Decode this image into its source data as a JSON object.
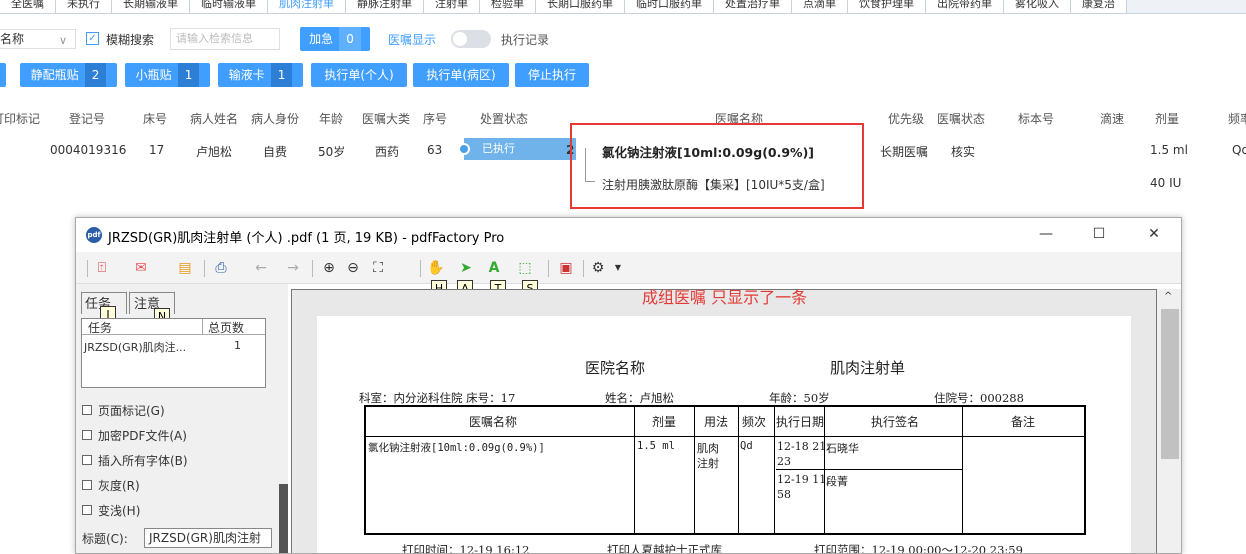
{
  "top_tabs": [
    {
      "label": "全医嘱",
      "active": false
    },
    {
      "label": "未执行",
      "active": false
    },
    {
      "label": "长期输液单",
      "active": false
    },
    {
      "label": "临时输液单",
      "active": false
    },
    {
      "label": "肌肉注射单",
      "active": true
    },
    {
      "label": "静脉注射单",
      "active": false
    },
    {
      "label": "注射单",
      "active": false
    },
    {
      "label": "检验单",
      "active": false
    },
    {
      "label": "长期口服药单",
      "active": false
    },
    {
      "label": "临时口服药单",
      "active": false
    },
    {
      "label": "处置治疗单",
      "active": false
    },
    {
      "label": "点滴单",
      "active": false
    },
    {
      "label": "饮食护理单",
      "active": false
    },
    {
      "label": "出院带药单",
      "active": false
    },
    {
      "label": "雾化吸入",
      "active": false
    },
    {
      "label": "康复治",
      "active": false
    }
  ],
  "filter": {
    "select_value": "名称",
    "fuzzy_checked": true,
    "fuzzy_label": "模糊搜索",
    "search_placeholder": "请输入检索信息",
    "urgent_label": "加急",
    "urgent_count": "0",
    "show_label": "医嘱显示",
    "exec_record_label": "执行记录"
  },
  "actions": [
    {
      "label": "静配瓶贴",
      "count": "2"
    },
    {
      "label": "小瓶贴",
      "count": "1"
    },
    {
      "label": "输液卡",
      "count": "1"
    },
    {
      "label": "执行单(个人)"
    },
    {
      "label": "执行单(病区)"
    },
    {
      "label": "停止执行"
    }
  ],
  "columns": [
    "打印标记",
    "登记号",
    "床号",
    "病人姓名",
    "病人身份",
    "年龄",
    "医嘱大类",
    "序号",
    "处置状态",
    "医嘱名称",
    "优先级",
    "医嘱状态",
    "标本号",
    "滴速",
    "剂量",
    "频率"
  ],
  "row": {
    "reg_no": "0004019316",
    "bed": "17",
    "name": "卢旭松",
    "identity": "自费",
    "age": "50岁",
    "category": "西药",
    "seq": "63",
    "status": "已执行",
    "status_num": "2",
    "priority": "长期医嘱",
    "order_status": "核实",
    "freq": "Qd"
  },
  "orders": [
    {
      "name": "氯化钠注射液[10ml:0.09g(0.9%)]",
      "dose": "1.5 ml"
    },
    {
      "name": "注射用胰激肽原酶【集采】[10IU*5支/盒]",
      "dose": "40 IU"
    }
  ],
  "pdf": {
    "window_title": "JRZSD(GR)肌肉注射单 (个人) .pdf (1 页, 19 KB) - pdfFactory Pro",
    "logo_text": "pdf",
    "hotkeys": [
      "H",
      "A",
      "T",
      "S"
    ],
    "side_hotkeys": [
      "J",
      "N"
    ],
    "annotation": "成组医嘱 只显示了一条",
    "left_tabs": [
      "任务",
      "注意"
    ],
    "list_headers": [
      "任务",
      "总页数"
    ],
    "list_item": {
      "name": "JRZSD(GR)肌肉注...",
      "pages": "1"
    },
    "options": [
      "页面标记(G)",
      "加密PDF文件(A)",
      "插入所有字体(B)",
      "灰度(R)",
      "变浅(H)"
    ],
    "title_label": "标题(C):",
    "title_value": "JRZSD(GR)肌肉注射",
    "doc": {
      "hospital": "医院名称",
      "doc_title": "肌肉注射单",
      "info": {
        "dept": "科室：内分泌科住院",
        "bed": "床号：17",
        "name": "姓名：卢旭松",
        "age": "年龄：50岁",
        "admission": "住院号：000288"
      },
      "headers": [
        "医嘱名称",
        "剂量",
        "用法",
        "频次",
        "执行日期",
        "执行签名",
        "备注"
      ],
      "row": {
        "name": "氯化钠注射液[10ml:0.09g(0.9%)]",
        "dose": "1.5 ml",
        "route_1": "肌肉",
        "route_2": "注射",
        "freq": "Qd",
        "date1a": "12-18 21:",
        "date1b": "23",
        "sign1": "石晓华",
        "date2a": "12-19 11:",
        "date2b": "58",
        "sign2": "段菁"
      },
      "footer": {
        "print_time": "打印时间：12-19 16:12",
        "printer": "打印人夏越护士正式库",
        "range": "打印范围：12-19 00:00～12-20 23:59"
      }
    }
  },
  "colors": {
    "accent": "#409eff",
    "annotation_red": "#e53935"
  }
}
